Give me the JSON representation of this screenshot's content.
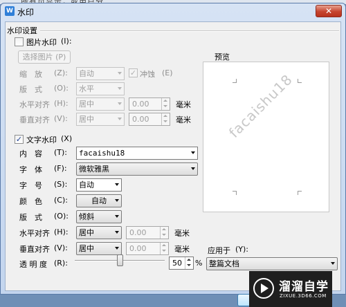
{
  "background": {
    "partial_text": "所有页显示，或用户分"
  },
  "window": {
    "title": "水印",
    "close_glyph": "✕"
  },
  "section": {
    "title": "水印设置"
  },
  "picture": {
    "checkbox_label": "图片水印",
    "checkbox_key": "(I):",
    "checked": false,
    "select_button": "选择图片 (P)",
    "scale": {
      "label": "缩　放",
      "key": "(Z):",
      "value": "自动"
    },
    "washout": {
      "label": "冲蚀",
      "key": "(E)",
      "checked": true
    },
    "layout": {
      "label": "版　式",
      "key": "(O):",
      "value": "水平"
    },
    "halign": {
      "label": "水平对齐",
      "key": "(H):",
      "value": "居中",
      "offset": "0.00",
      "unit": "毫米"
    },
    "valign": {
      "label": "垂直对齐",
      "key": "(V):",
      "value": "居中",
      "offset": "0.00",
      "unit": "毫米"
    }
  },
  "text": {
    "checkbox_label": "文字水印",
    "checkbox_key": "(X)",
    "checked": true,
    "content": {
      "label": "内　容",
      "key": "(T):",
      "value": "facaishu18"
    },
    "font": {
      "label": "字　体",
      "key": "(F):",
      "value": "微软雅黑"
    },
    "size": {
      "label": "字　号",
      "key": "(S):",
      "value": "自动"
    },
    "color": {
      "label": "颜　色",
      "key": "(C):",
      "value": "自动"
    },
    "layout": {
      "label": "版　式",
      "key": "(O):",
      "value": "倾斜"
    },
    "halign": {
      "label": "水平对齐",
      "key": "(H):",
      "value": "居中",
      "offset": "0.00",
      "unit": "毫米"
    },
    "valign": {
      "label": "垂直对齐",
      "key": "(V):",
      "value": "居中",
      "offset": "0.00",
      "unit": "毫米"
    },
    "transparency": {
      "label": "透 明 度",
      "key": "(R):",
      "value": "50",
      "unit": "%",
      "level": 0.5
    }
  },
  "preview": {
    "label": "预览",
    "watermark_text": "facaishu18"
  },
  "apply": {
    "label": "应用于",
    "key": "(Y):",
    "value": "整篇文档"
  },
  "brand_badge": {
    "title": "溜溜自学",
    "subtitle": "ZIXUE.3D66.COM"
  },
  "colors": {
    "title_gradient_top": "#d6e3f4",
    "close_red": "#c6442e",
    "dialog_face": "#f0f0f0",
    "check_blue": "#1c3f94"
  }
}
